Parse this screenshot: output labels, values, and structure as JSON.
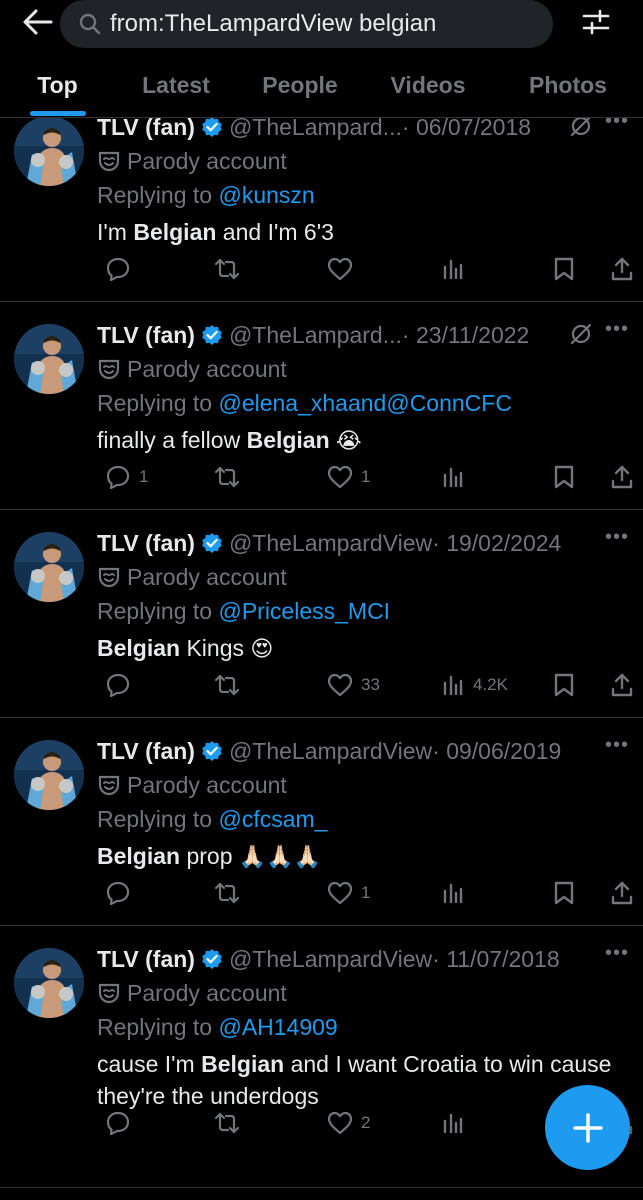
{
  "search": {
    "query": "from:TheLampardView belgian"
  },
  "tabs": [
    "Top",
    "Latest",
    "People",
    "Videos",
    "Photos"
  ],
  "tweets": [
    {
      "name": "TLV (fan)",
      "handle": "@TheLampard...",
      "date": "· 06/07/2018",
      "parody": "Parody account",
      "replying_prefix": "Replying to",
      "replying_to": "@kunszn",
      "replying_and": "",
      "replying_to2": "",
      "text_before": "I'm ",
      "text_bold": "Belgian",
      "text_after": " and I'm 6'3",
      "emoji": "",
      "replies": "",
      "likes": "",
      "views": ""
    },
    {
      "name": "TLV (fan)",
      "handle": "@TheLampard...",
      "date": "· 23/11/2022",
      "parody": "Parody account",
      "replying_prefix": "Replying to",
      "replying_to": "@elena_xha",
      "replying_and": " and ",
      "replying_to2": "@ConnCFC",
      "text_before": "finally a fellow ",
      "text_bold": "Belgian",
      "text_after": " ",
      "emoji": "😭",
      "replies": "1",
      "likes": "1",
      "views": ""
    },
    {
      "name": "TLV (fan)",
      "handle": "@TheLampardView",
      "date": "· 19/02/2024",
      "parody": "Parody account",
      "replying_prefix": "Replying to",
      "replying_to": "@Priceless_MCI",
      "replying_and": "",
      "replying_to2": "",
      "text_before": "",
      "text_bold": "Belgian",
      "text_after": " Kings ",
      "emoji": "😍",
      "replies": "",
      "likes": "33",
      "views": "4.2K"
    },
    {
      "name": "TLV (fan)",
      "handle": "@TheLampardView",
      "date": "· 09/06/2019",
      "parody": "Parody account",
      "replying_prefix": "Replying to",
      "replying_to": "@cfcsam_",
      "replying_and": "",
      "replying_to2": "",
      "text_before": "",
      "text_bold": "Belgian",
      "text_after": " prop ",
      "emoji": "🙏🏻🙏🏻🙏🏻",
      "replies": "",
      "likes": "1",
      "views": ""
    },
    {
      "name": "TLV (fan)",
      "handle": "@TheLampardView",
      "date": "· 11/07/2018",
      "parody": "Parody account",
      "replying_prefix": "Replying to",
      "replying_to": "@AH14909",
      "replying_and": "",
      "replying_to2": "",
      "text_before": "cause I'm ",
      "text_bold": "Belgian",
      "text_after": " and I want Croatia to win cause they're the underdogs",
      "emoji": "",
      "replies": "",
      "likes": "2",
      "views": ""
    }
  ],
  "colors": {
    "accent": "#1d9bf0",
    "muted": "#71767b",
    "text": "#e7e9ea",
    "background": "#000000"
  },
  "icons": [
    "back-arrow-icon",
    "search-icon",
    "filter-sliders-icon",
    "verified-badge-icon",
    "grok-icon",
    "more-icon",
    "parody-mask-icon",
    "reply-icon",
    "retweet-icon",
    "like-icon",
    "views-icon",
    "bookmark-icon",
    "share-icon",
    "compose-plus-icon"
  ]
}
